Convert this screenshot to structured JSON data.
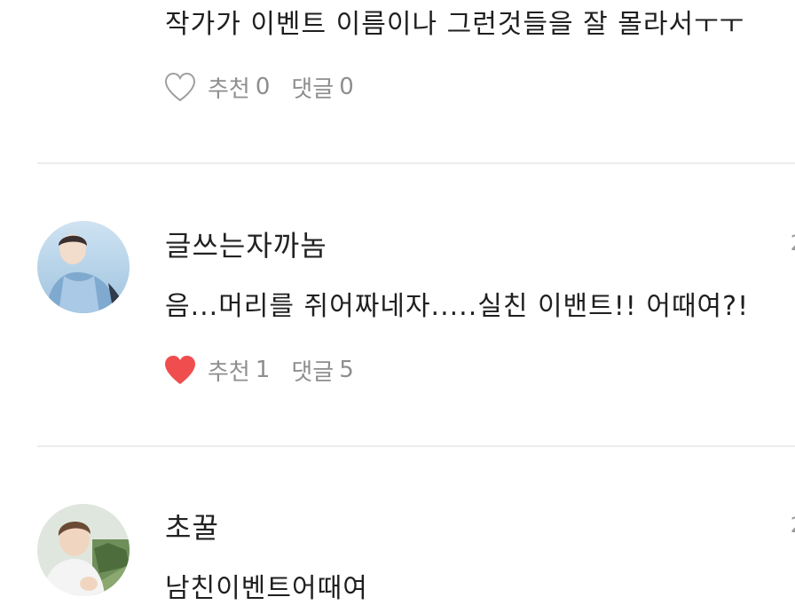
{
  "comments": [
    {
      "text": "작가가 이벤트 이름이나 그런것들을 잘 몰라서ㅜㅜ",
      "like_label": "추천",
      "like_count": "0",
      "reply_label": "댓글",
      "reply_count": "0",
      "liked": false
    },
    {
      "author": "글쓰는자까놈",
      "date": "2",
      "text": "음...머리를 쥐어짜네자.....실친 이밴트!! 어때여?!",
      "like_label": "추천",
      "like_count": "1",
      "reply_label": "댓글",
      "reply_count": "5",
      "liked": true
    },
    {
      "author": "초꿀",
      "date": "2",
      "text": "남친이벤트어때여"
    }
  ],
  "colors": {
    "heart_liked": "#f04e4e",
    "heart_outline": "#a0a0a0",
    "divider": "#ececec",
    "meta_text": "#8e8e8e"
  }
}
